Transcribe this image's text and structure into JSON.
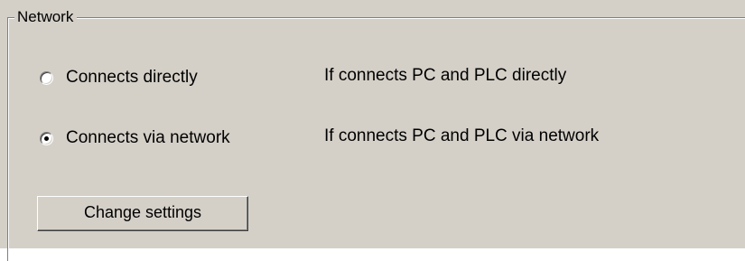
{
  "groupbox": {
    "title": "Network"
  },
  "options": [
    {
      "label": "Connects directly",
      "description": "If connects PC and PLC directly",
      "selected": false
    },
    {
      "label": "Connects via network",
      "description": "If connects PC and PLC via network",
      "selected": true
    }
  ],
  "buttons": {
    "change_settings": "Change settings"
  }
}
